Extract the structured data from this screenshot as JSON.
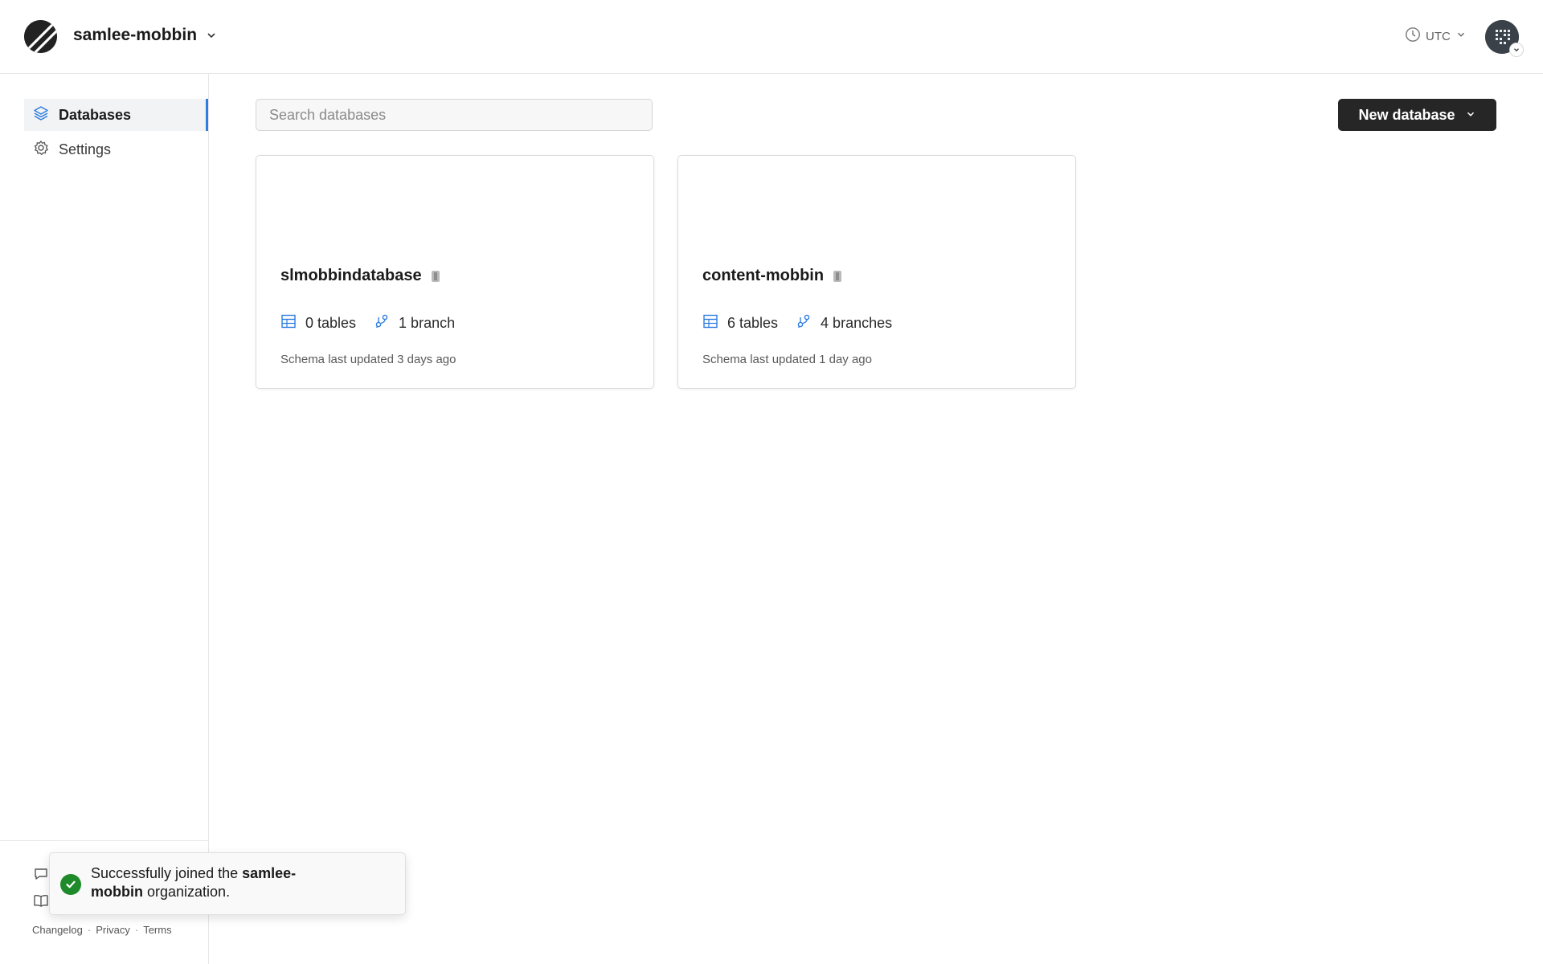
{
  "header": {
    "org_name": "samlee-mobbin",
    "timezone": "UTC"
  },
  "sidebar": {
    "items": [
      {
        "label": "Databases",
        "icon": "layers-icon",
        "active": true
      },
      {
        "label": "Settings",
        "icon": "gear-icon",
        "active": false
      }
    ],
    "footer_links": [
      "Changelog",
      "Privacy",
      "Terms"
    ]
  },
  "main": {
    "search_placeholder": "Search databases",
    "new_button_label": "New database",
    "databases": [
      {
        "name": "slmobbindatabase",
        "tables": "0 tables",
        "branches": "1 branch",
        "updated": "Schema last updated 3 days ago"
      },
      {
        "name": "content-mobbin",
        "tables": "6 tables",
        "branches": "4 branches",
        "updated": "Schema last updated 1 day ago"
      }
    ]
  },
  "toast": {
    "prefix": "Successfully joined the ",
    "org": "samlee-mobbin",
    "suffix": " organization."
  },
  "colors": {
    "accent": "#2f7de0",
    "button_dark": "#262626",
    "success": "#1f8a2a"
  }
}
